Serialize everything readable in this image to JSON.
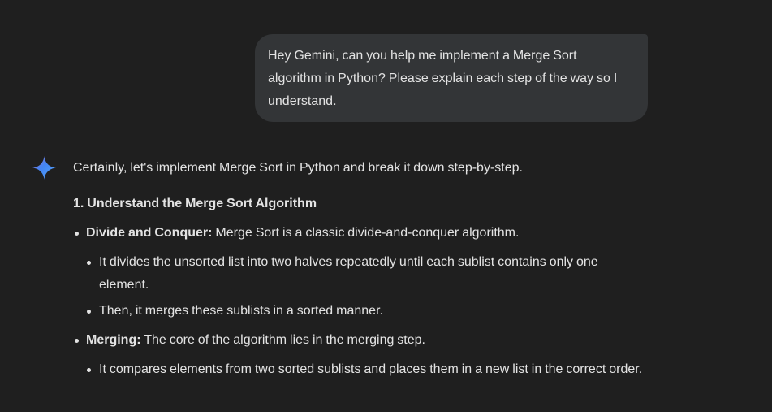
{
  "user_message": {
    "text": "Hey Gemini, can you help me implement a Merge Sort algorithm in Python? Please explain each step of the way so I understand."
  },
  "response": {
    "icon": "gemini-sparkle-icon",
    "intro": "Certainly, let's implement Merge Sort in Python and break it down step-by-step.",
    "heading": "1. Understand the Merge Sort Algorithm",
    "bullets": [
      {
        "bold": "Divide and Conquer:",
        "text": " Merge Sort is a classic divide-and-conquer algorithm."
      },
      {
        "text": "It divides the unsorted list into two halves repeatedly until each sublist contains only one element."
      },
      {
        "text": "Then, it merges these sublists in a sorted manner."
      },
      {
        "bold": "Merging:",
        "text": " The core of the algorithm lies in the merging step."
      },
      {
        "text": "It compares elements from two sorted sublists and places them in a new list in the correct order."
      }
    ]
  },
  "colors": {
    "background": "#1f1f1f",
    "user_bubble": "#333537",
    "text": "#e3e3e3",
    "sparkle_gradient": [
      "#4285f4",
      "#9b72cb",
      "#d96570"
    ]
  }
}
